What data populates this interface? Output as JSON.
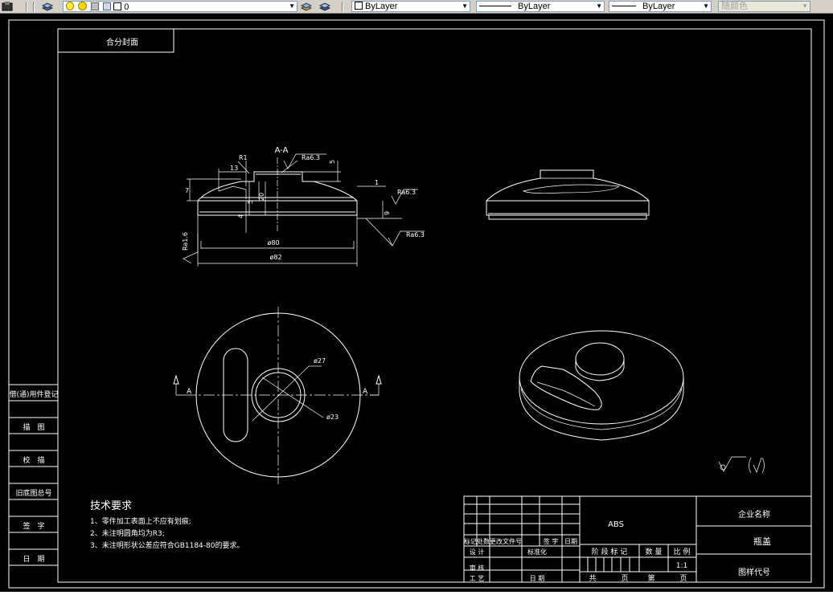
{
  "toolbar": {
    "layer_name": "0",
    "color_label": "ByLayer",
    "linetype_label": "ByLayer",
    "lineweight_label": "ByLayer",
    "plotstyle_label": "随颜色"
  },
  "icons": [
    "layer-manager-icon",
    "layer-state-icon",
    "lightbulb-on-icon",
    "sun-thaw-icon",
    "lock-icon",
    "color-square-icon",
    "make-current-icon",
    "layer-previous-icon"
  ],
  "drawing": {
    "title_label": "合分封面",
    "section_label": "A-A",
    "dims": {
      "r1": "R1",
      "d13": "13",
      "d7": "7",
      "d5a": "5",
      "d20": "20",
      "d4": "4",
      "d5b": "5",
      "d1": "1",
      "d9": "9",
      "d80": "ø80",
      "d82": "ø82",
      "ra63_top": "Ra6.3",
      "ra63_right": "Ra6.3",
      "ra63_bottom": "Ra6.3",
      "ra16": "Ra1.6",
      "d27": "ø27",
      "d23": "ø23",
      "a_left": "A",
      "a_right": "A"
    },
    "left_column": [
      "借(通)用件登记",
      "描　图",
      "校　描",
      "旧底图总号",
      "签　字",
      "日　期"
    ],
    "tech_title": "技术要求",
    "tech_items": [
      "1、零件加工表面上不应有划痕;",
      "2、未注明圆角均为R3;",
      "3、未注明形状公差应符合GB1184-80的要求。"
    ],
    "title_block": {
      "material": "ABS",
      "company": "企业名称",
      "part_name": "瓶盖",
      "drawing_no": "图样代号",
      "change_header": [
        "标记",
        "处数",
        "更改文件号",
        "签 字",
        "日期"
      ],
      "design": "设 计",
      "standard": "标准化",
      "review": "审 核",
      "process": "工 艺",
      "date": "日 期",
      "stage_mark": "阶 段 标 记",
      "quantity": "数 量",
      "scale": "比 例",
      "scale_value": "1:1",
      "total": "共",
      "page": "页",
      "sheet": "第",
      "page2": "页"
    }
  }
}
